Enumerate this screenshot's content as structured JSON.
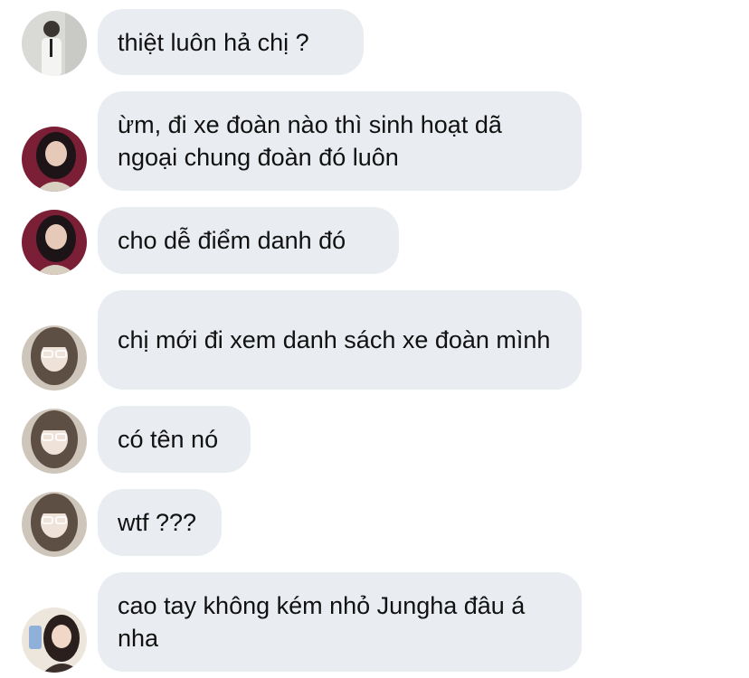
{
  "colors": {
    "bubble_bg": "#e9ecf1",
    "text": "#111111"
  },
  "messages": [
    {
      "text": "thiệt luôn hả chị ?",
      "avatar": "avatar-man-white-shirt"
    },
    {
      "text": "ừm, đi xe đoàn nào thì sinh hoạt dã ngoại chung đoàn đó luôn",
      "avatar": "avatar-girl-dark-hair"
    },
    {
      "text": "cho dễ điểm danh đó",
      "avatar": "avatar-girl-dark-hair"
    },
    {
      "text": "chị mới đi xem danh sách xe đoàn mình",
      "avatar": "avatar-girl-glasses"
    },
    {
      "text": "có tên nó",
      "avatar": "avatar-girl-glasses"
    },
    {
      "text": "wtf ???",
      "avatar": "avatar-girl-glasses"
    },
    {
      "text": "cao tay không kém nhỏ Jungha đâu á nha",
      "avatar": "avatar-girl-phone-selfie"
    }
  ]
}
